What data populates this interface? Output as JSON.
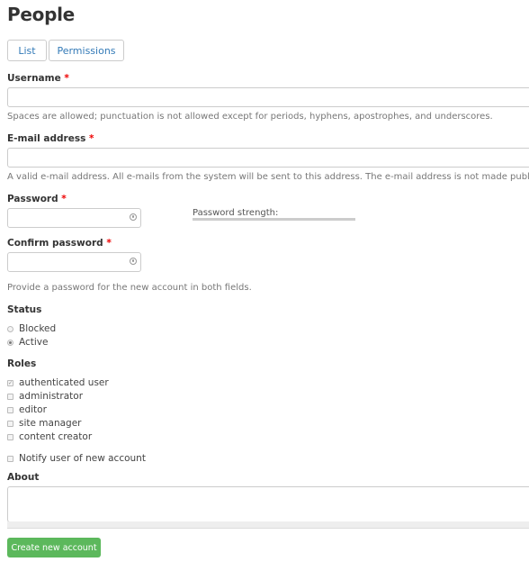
{
  "page": {
    "title": "People"
  },
  "tabs": [
    {
      "label": "List"
    },
    {
      "label": "Permissions"
    }
  ],
  "form": {
    "required_marker": "*",
    "username": {
      "label": "Username",
      "value": "",
      "help": "Spaces are allowed; punctuation is not allowed except for periods, hyphens, apostrophes, and underscores."
    },
    "email": {
      "label": "E-mail address",
      "value": "",
      "help": "A valid e-mail address. All e-mails from the system will be sent to this address. The e-mail address is not made public"
    },
    "password": {
      "label": "Password",
      "value": "",
      "strength_label": "Password strength:",
      "strength_value": 0
    },
    "confirm_password": {
      "label": "Confirm password",
      "value": "",
      "help": "Provide a password for the new account in both fields."
    },
    "status": {
      "label": "Status",
      "options": [
        {
          "label": "Blocked",
          "selected": false
        },
        {
          "label": "Active",
          "selected": true
        }
      ]
    },
    "roles": {
      "label": "Roles",
      "options": [
        {
          "label": "authenticated user",
          "checked": true,
          "disabled": true
        },
        {
          "label": "administrator",
          "checked": false
        },
        {
          "label": "editor",
          "checked": false
        },
        {
          "label": "site manager",
          "checked": false
        },
        {
          "label": "content creator",
          "checked": false
        }
      ]
    },
    "notify": {
      "label": "Notify user of new account",
      "checked": false
    },
    "about": {
      "label": "About",
      "value": ""
    },
    "submit_label": "Create new account"
  },
  "colors": {
    "accent_link": "#337ab7",
    "submit": "#5cb85c",
    "required": "#ee0000"
  }
}
